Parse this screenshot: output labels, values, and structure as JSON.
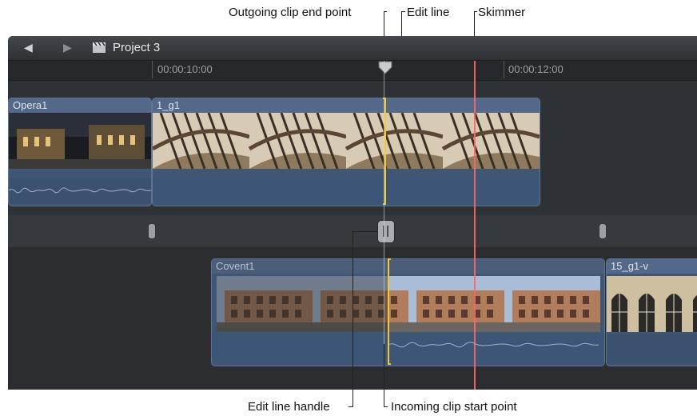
{
  "callouts": {
    "outgoing": "Outgoing clip end point",
    "edit_line": "Edit line",
    "skimmer": "Skimmer",
    "edit_line_handle": "Edit line handle",
    "incoming": "Incoming clip start point"
  },
  "titlebar": {
    "project_name": "Project 3"
  },
  "ruler": {
    "tc_left": "00:00:10:00",
    "tc_right": "00:00:12:00"
  },
  "clips": {
    "opera1": "Opera1",
    "g1": "1_g1",
    "covent1": "Covent1",
    "g1v": "15_g1-v"
  },
  "colors": {
    "skimmer": "#ff6666",
    "edit_point": "#f5c730",
    "clip_body": "#3f5674"
  }
}
